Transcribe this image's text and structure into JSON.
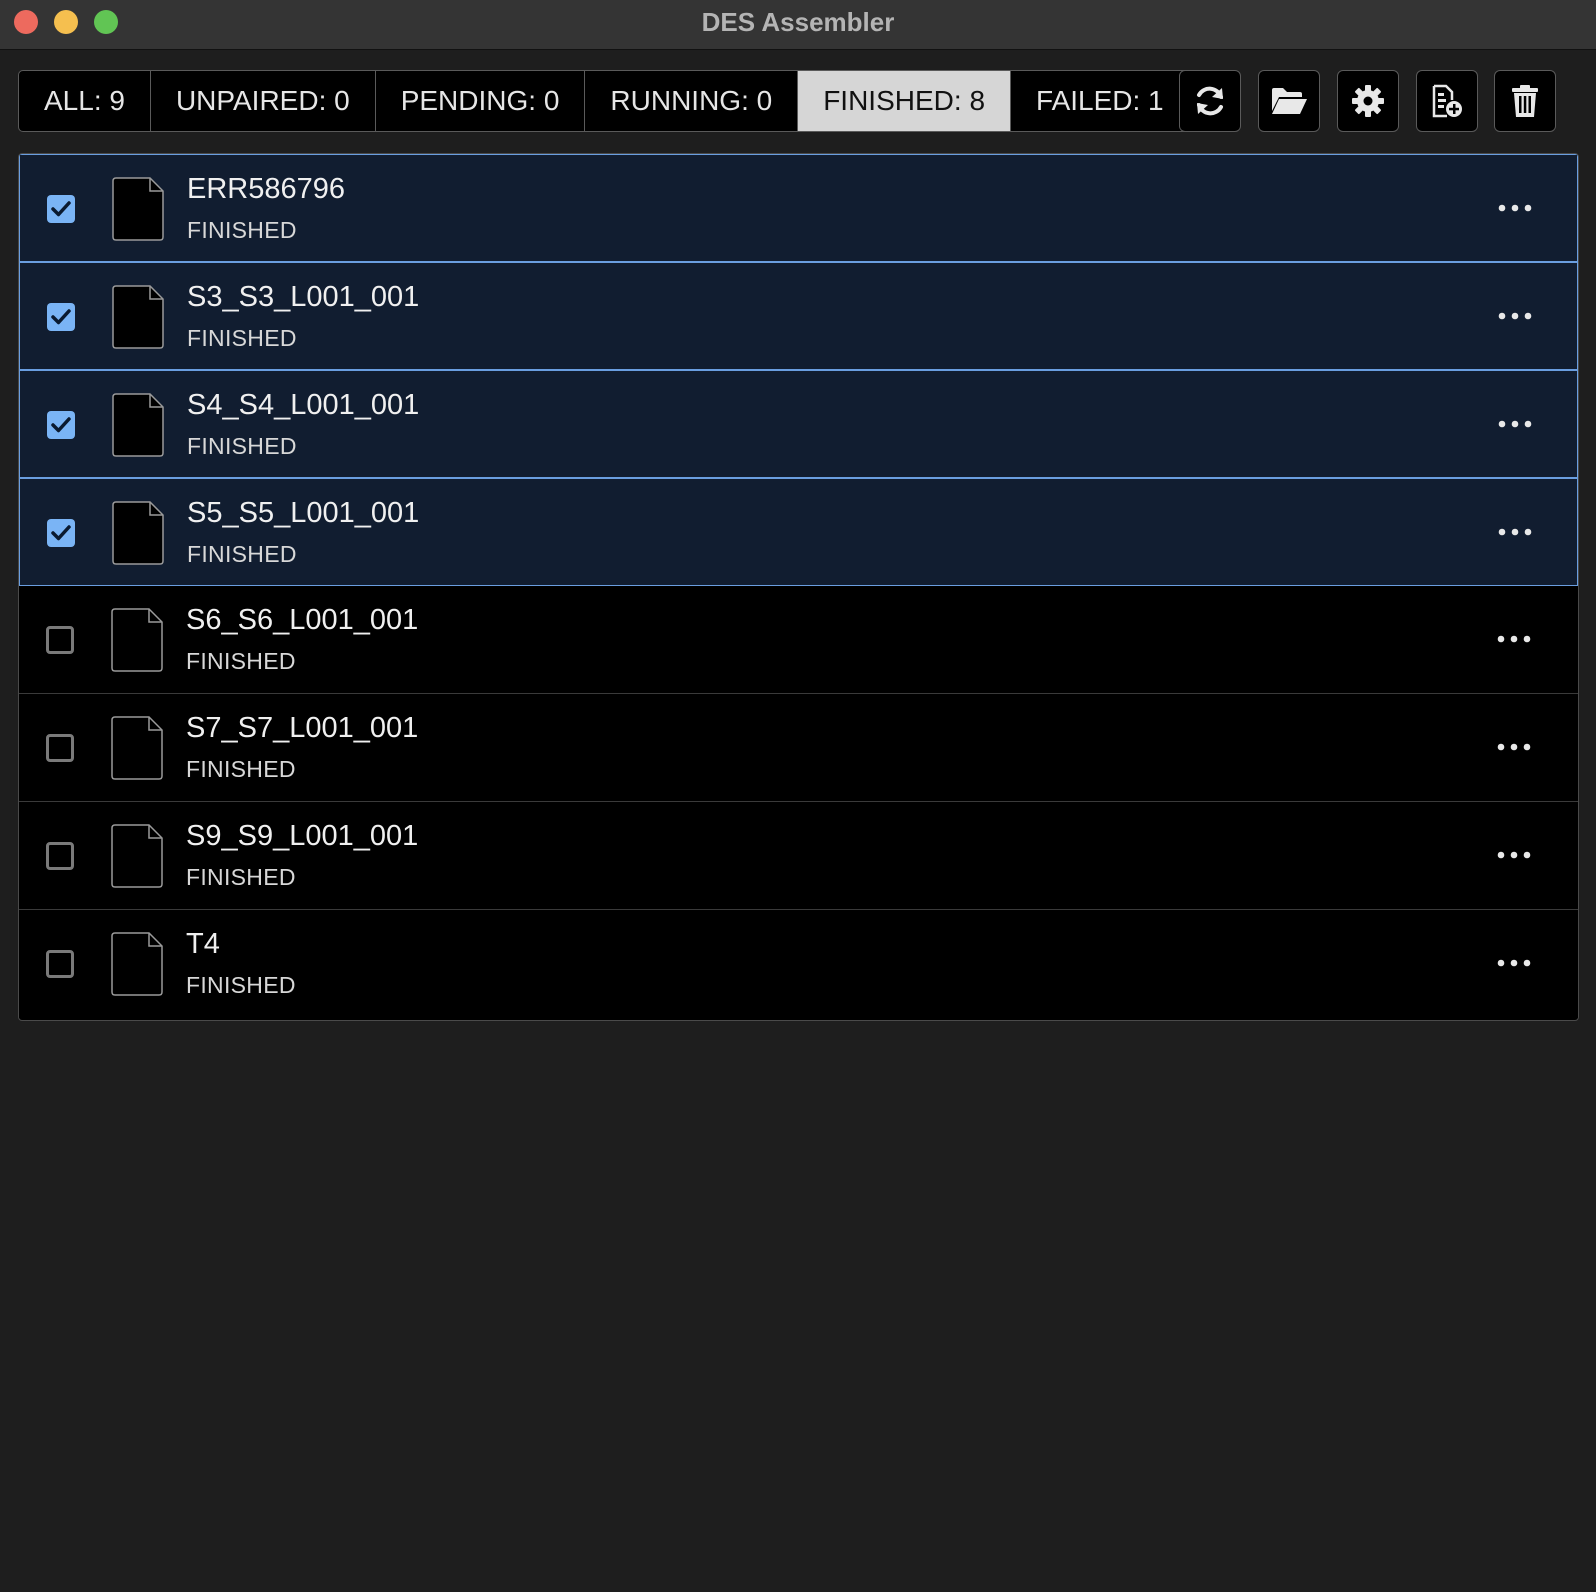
{
  "window": {
    "title": "DES Assembler"
  },
  "tabs": [
    {
      "label": "ALL: 9",
      "active": false
    },
    {
      "label": "UNPAIRED: 0",
      "active": false
    },
    {
      "label": "PENDING: 0",
      "active": false
    },
    {
      "label": "RUNNING: 0",
      "active": false
    },
    {
      "label": "FINISHED: 8",
      "active": true
    },
    {
      "label": "FAILED: 1",
      "active": false
    }
  ],
  "toolbar": [
    {
      "icon": "refresh-icon",
      "action": "refresh"
    },
    {
      "icon": "folder-open-icon",
      "action": "open-folder"
    },
    {
      "icon": "gear-icon",
      "action": "settings"
    },
    {
      "icon": "file-add-icon",
      "action": "add-file"
    },
    {
      "icon": "trash-icon",
      "action": "delete"
    }
  ],
  "rows": [
    {
      "name": "ERR586796",
      "status": "FINISHED",
      "checked": true
    },
    {
      "name": "S3_S3_L001_001",
      "status": "FINISHED",
      "checked": true
    },
    {
      "name": "S4_S4_L001_001",
      "status": "FINISHED",
      "checked": true
    },
    {
      "name": "S5_S5_L001_001",
      "status": "FINISHED",
      "checked": true
    },
    {
      "name": "S6_S6_L001_001",
      "status": "FINISHED",
      "checked": false
    },
    {
      "name": "S7_S7_L001_001",
      "status": "FINISHED",
      "checked": false
    },
    {
      "name": "S9_S9_L001_001",
      "status": "FINISHED",
      "checked": false
    },
    {
      "name": "T4",
      "status": "FINISHED",
      "checked": false
    }
  ],
  "colors": {
    "selected_row_bg": "#111d30",
    "selected_row_border": "#6a9ee0",
    "checkbox_checked": "#7ab4f5",
    "active_tab_bg": "#d6d6d6"
  }
}
